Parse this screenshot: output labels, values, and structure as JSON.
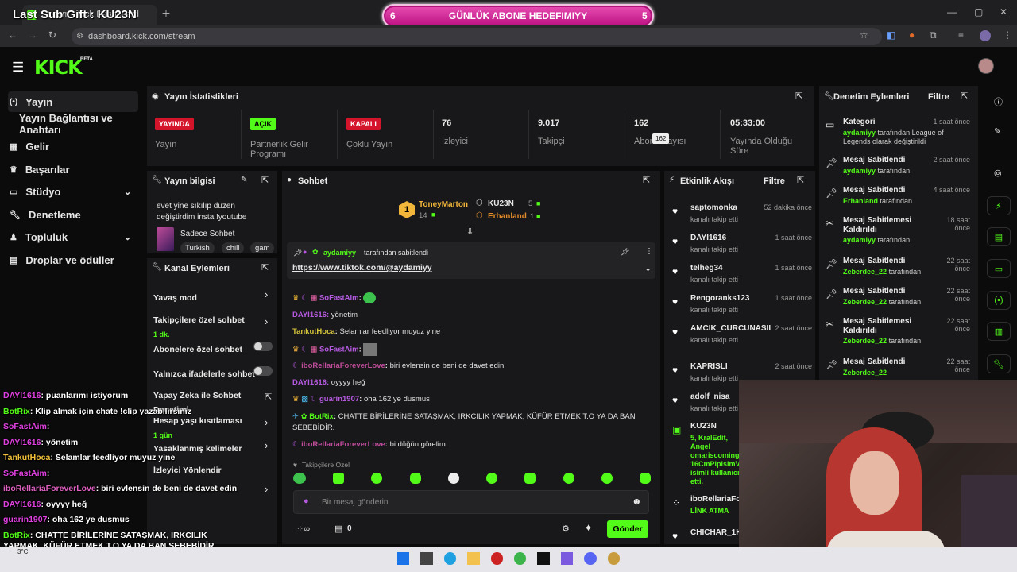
{
  "overlay": {
    "last_sub": "Last Sub Gift : KU23N",
    "goal_left": "6",
    "goal_title": "GÜNLÜK ABONE HEDEFIMIYY",
    "goal_right": "5"
  },
  "browser": {
    "tab_title": "Stream - Kick Dashboard",
    "url": "dashboard.kick.com/stream"
  },
  "kick": {
    "logo": "KICK",
    "beta": "BETA"
  },
  "sidebar": {
    "items": [
      "Yayın",
      "Yayın Bağlantısı ve Anahtarı",
      "Gelir",
      "Başarılar",
      "Stüdyo",
      "Denetleme",
      "Topluluk",
      "Droplar ve ödüller"
    ]
  },
  "stats": {
    "title": "Yayın İstatistikleri",
    "items": [
      {
        "value": "YAYINDA",
        "label": "Yayın"
      },
      {
        "value": "AÇIK",
        "label": "Partnerlik Gelir Programı"
      },
      {
        "value": "KAPALI",
        "label": "Çoklu Yayın"
      },
      {
        "value": "76",
        "label": "İzleyici"
      },
      {
        "value": "9.017",
        "label": "Takipçi"
      },
      {
        "value": "162",
        "label": "Abone Sayısı",
        "tooltip": "162"
      },
      {
        "value": "05:33:00",
        "label": "Yayında Olduğu Süre"
      }
    ]
  },
  "stream_info": {
    "title": "Yayın bilgisi",
    "stream_title": "evet yine sıkılıp düzen değiştirdim insta !youtube",
    "category": "Sadece Sohbet",
    "tags": [
      "Turkish",
      "chill",
      "gam"
    ]
  },
  "channel_actions": {
    "title": "Kanal Eylemleri",
    "items": [
      {
        "label": "Yavaş mod",
        "sub": ""
      },
      {
        "label": "Takipçilere özel sohbet",
        "sub": "1 dk."
      },
      {
        "label": "Abonelere özel sohbet",
        "sub": ""
      },
      {
        "label": "Yalnızca ifadelerle sohbet",
        "sub": ""
      },
      {
        "label": "Yapay Zeka ile Sohbet Denetimi",
        "sub": ""
      },
      {
        "label": "Hesap yaşı kısıtlaması",
        "sub": "1 gün"
      },
      {
        "label": "Yasaklanmış kelimeler",
        "sub": ""
      },
      {
        "label": "İzleyici Yönlendir",
        "sub": ""
      }
    ]
  },
  "chat": {
    "title": "Sohbet",
    "top_gifters": [
      {
        "name": "ToneyMarton",
        "count": "14"
      },
      {
        "name": "KU23N",
        "count": "5"
      },
      {
        "name": "Erhanland",
        "count": "1"
      }
    ],
    "pinned_by": "aydamiyy",
    "pinned_suffix": "tarafından sabitlendi",
    "pinned_link": "https://www.tiktok.com/@aydamiyy",
    "messages": [
      {
        "user": "SoFastAim",
        "text": ""
      },
      {
        "user": "DAYI1616",
        "text": "yönetim"
      },
      {
        "user": "TankutHoca",
        "text": "Selamlar feedliyor muyuz yine"
      },
      {
        "user": "SoFastAim",
        "text": ""
      },
      {
        "user": "iboRellariaForeverLove",
        "text": "biri evlensin de beni de davet edin"
      },
      {
        "user": "DAYI1616",
        "text": "oyyyy heğ"
      },
      {
        "user": "guarin1907",
        "text": "oha 162 ye dusmus"
      },
      {
        "user": "BotRix",
        "text": "CHATTE BİRİLERİNE SATAŞMAK, IRKCILIK YAPMAK, KÜFÜR ETMEK T.O YA DA BAN SEBEBİDİR."
      },
      {
        "user": "iboRellariaForeverLove",
        "text": "bi düğün görelim"
      }
    ],
    "followers_only": "Takipçilere Özel",
    "input_placeholder": "Bir mesaj gönderin",
    "points": "0",
    "send_label": "Gönder"
  },
  "activity": {
    "title": "Etkinlik Akışı",
    "filter": "Filtre",
    "items": [
      {
        "name": "saptomonka",
        "desc": "kanalı takip etti",
        "time": "52 dakika önce"
      },
      {
        "name": "DAYI1616",
        "desc": "kanalı takip etti",
        "time": "1 saat önce"
      },
      {
        "name": "telheg34",
        "desc": "kanalı takip etti",
        "time": "1 saat önce"
      },
      {
        "name": "Rengoranks123",
        "desc": "kanalı takip etti",
        "time": "1 saat önce"
      },
      {
        "name": "AMCIK_CURCUNASII",
        "desc": "kanalı takip etti",
        "time": "2 saat önce"
      },
      {
        "name": "KAPRISLI",
        "desc": "kanalı takip etti",
        "time": "2 saat önce"
      },
      {
        "name": "adolf_nisa",
        "desc": "kanalı takip etti",
        "time": ""
      },
      {
        "name": "KU23N",
        "desc": "5, KralEdit, Angel omariscoming, 16CmPipisimVa isimli kullanıcı etti.",
        "time": ""
      },
      {
        "name": "iboRellariaFo",
        "desc": "LİNK ATMA",
        "time": ""
      },
      {
        "name": "CHICHAR_1K",
        "desc": "",
        "time": ""
      }
    ]
  },
  "moderation": {
    "title": "Denetim Eylemleri",
    "filter": "Filtre",
    "items": [
      {
        "title": "Kategori",
        "time": "1 saat önce",
        "user": "aydamiyy",
        "desc": "tarafından League of Legends olarak değiştirildi"
      },
      {
        "title": "Mesaj Sabitlendi",
        "time": "2 saat önce",
        "user": "aydamiyy",
        "desc": "tarafından"
      },
      {
        "title": "Mesaj Sabitlendi",
        "time": "4 saat önce",
        "user": "Erhanland",
        "desc": "tarafından"
      },
      {
        "title": "Mesaj Sabitlemesi Kaldırıldı",
        "time": "18 saat önce",
        "user": "aydamiyy",
        "desc": "tarafından"
      },
      {
        "title": "Mesaj Sabitlendi",
        "time": "22 saat önce",
        "user": "Zeberdee_22",
        "desc": "tarafından"
      },
      {
        "title": "Mesaj Sabitlendi",
        "time": "22 saat önce",
        "user": "Zeberdee_22",
        "desc": "tarafından"
      },
      {
        "title": "Mesaj Sabitlemesi Kaldırıldı",
        "time": "22 saat önce",
        "user": "Zeberdee_22",
        "desc": "tarafından"
      },
      {
        "title": "Mesaj Sabitlendi",
        "time": "22 saat önce",
        "user": "Zeberdee_22",
        "desc": ""
      }
    ]
  },
  "overlay_chat": [
    {
      "user": "DAYI1616",
      "text": "puanlarımı istiyorum"
    },
    {
      "user": "BotRix",
      "text": "Klip almak için chate !clip yazabilirsiniz"
    },
    {
      "user": "SoFastAim",
      "text": ""
    },
    {
      "user": "DAYI1616",
      "text": "yönetim"
    },
    {
      "user": "TankutHoca",
      "text": "Selamlar feedliyor muyuz yine"
    },
    {
      "user": "SoFastAim",
      "text": ""
    },
    {
      "user": "iboRellariaForeverLove",
      "text": "biri evlensin de beni de davet edin"
    },
    {
      "user": "DAYI1616",
      "text": "oyyyy heğ"
    },
    {
      "user": "guarin1907",
      "text": "oha 162 ye dusmus"
    },
    {
      "user": "BotRix",
      "text": "CHATTE BİRİLERİNE SATAŞMAK, IRKCILIK YAPMAK, KÜFÜR ETMEK T.O YA DA BAN SEBEBİDİR."
    },
    {
      "user": "iboRellariaForeverLove",
      "text": "bi düğün görelim"
    }
  ],
  "taskbar": {
    "temp": "3°C"
  },
  "colors": {
    "accent": "#53fc18",
    "live_red": "#d4142a",
    "goal_pink": "#d21a8f"
  }
}
